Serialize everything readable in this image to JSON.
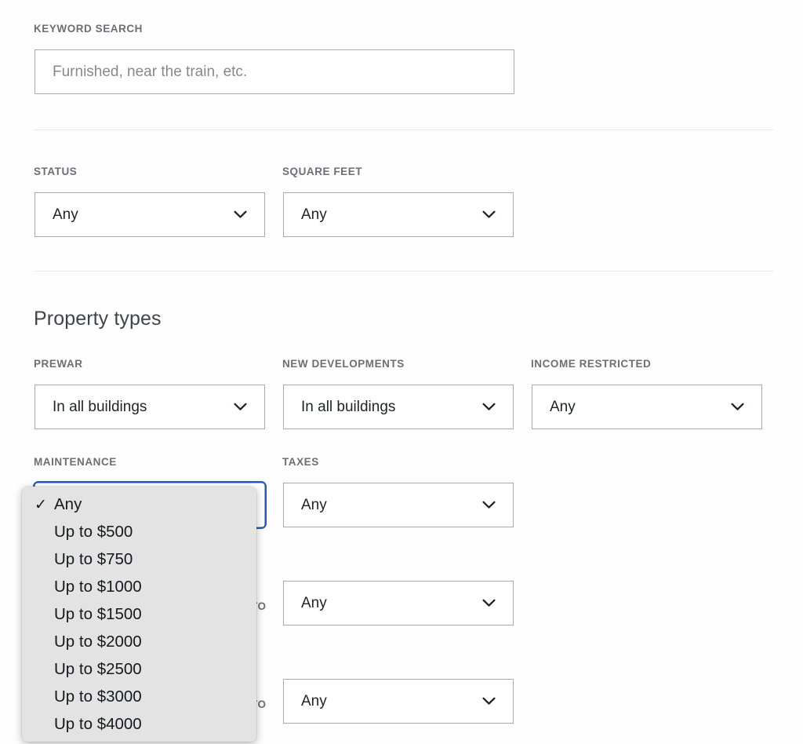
{
  "keyword_section": {
    "label": "KEYWORD SEARCH",
    "input": {
      "value": "",
      "placeholder": "Furnished, near the train, etc."
    }
  },
  "filters_row": {
    "status": {
      "label": "STATUS",
      "value": "Any"
    },
    "square_feet": {
      "label": "SQUARE FEET",
      "value": "Any"
    }
  },
  "property_types": {
    "heading": "Property types",
    "prewar": {
      "label": "PREWAR",
      "value": "In all buildings"
    },
    "new_developments": {
      "label": "NEW DEVELOPMENTS",
      "value": "In all buildings"
    },
    "income_restricted": {
      "label": "INCOME RESTRICTED",
      "value": "Any"
    }
  },
  "cost_row": {
    "maintenance": {
      "label": "MAINTENANCE",
      "value": "Any"
    },
    "taxes": {
      "label": "TAXES",
      "value": "Any"
    }
  },
  "range_rows": [
    {
      "to_label": "TO",
      "value": "Any"
    },
    {
      "to_label": "TO",
      "value": "Any"
    }
  ],
  "maintenance_dropdown": {
    "open": true,
    "selected_index": 0,
    "check_glyph": "✓",
    "options": [
      "Any",
      "Up to $500",
      "Up to $750",
      "Up to $1000",
      "Up to $1500",
      "Up to $2000",
      "Up to $2500",
      "Up to $3000",
      "Up to $4000"
    ]
  },
  "icons": {
    "chevron_down": "chevron-down-icon"
  },
  "colors": {
    "page_background": "#fefefe",
    "label_text": "#6a6f76",
    "value_text": "#1f2328",
    "border": "#a8aaad",
    "divider": "#e8e9ea",
    "focus_ring": "#2158c8",
    "popup_background": "#e3e3e3"
  }
}
